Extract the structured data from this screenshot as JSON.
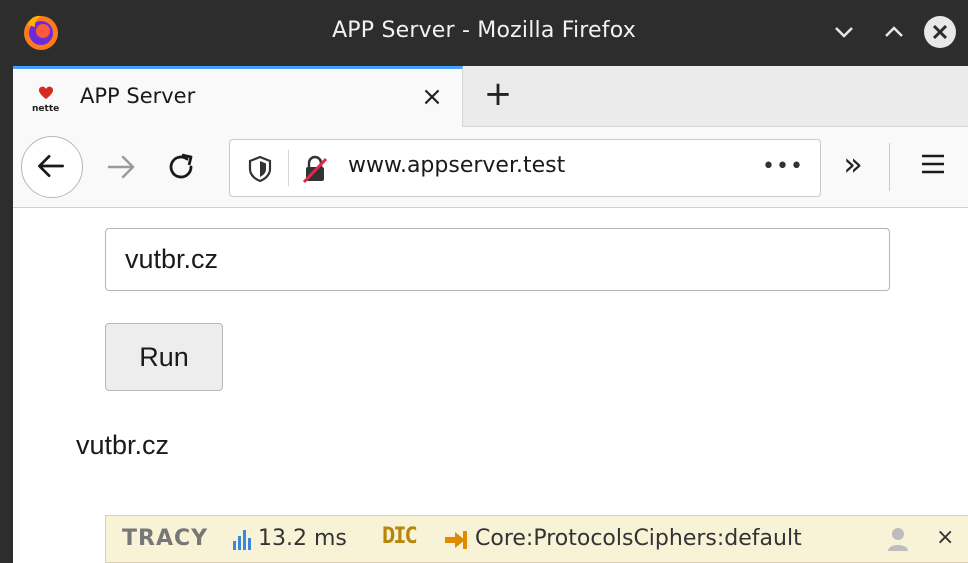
{
  "window": {
    "title": "APP Server - Mozilla Firefox"
  },
  "tab": {
    "title": "APP Server",
    "close": "×"
  },
  "new_tab": "+",
  "urlbar": {
    "url": "www.appserver.test",
    "page_actions": "•••"
  },
  "toolbar": {
    "overflow": "»"
  },
  "form": {
    "input_value": "vutbr.cz",
    "run_label": "Run"
  },
  "output": {
    "text": "vutbr.cz"
  },
  "tracy": {
    "logo": "TRACY",
    "time": "13.2 ms",
    "dic": "DIC",
    "route": "Core:ProtocolsCiphers:default",
    "close": "×"
  },
  "colors": {
    "titlebar": "#2d2d2d",
    "tab_accent": "#45a1ff",
    "tracy_bg": "#f8f2d6",
    "tracy_dic": "#b8860b",
    "tracy_time_icon": "#3a88d8",
    "tracy_route_icon": "#e08a00"
  },
  "icons": {
    "window": [
      "firefox-logo-icon",
      "minimize-icon",
      "maximize-icon",
      "close-icon"
    ],
    "nav": [
      "back-icon",
      "forward-icon",
      "reload-icon",
      "shield-icon",
      "insecure-lock-icon",
      "overflow-icon",
      "hamburger-menu-icon"
    ],
    "tracy": [
      "bar-chart-icon",
      "route-icon",
      "user-icon"
    ]
  }
}
